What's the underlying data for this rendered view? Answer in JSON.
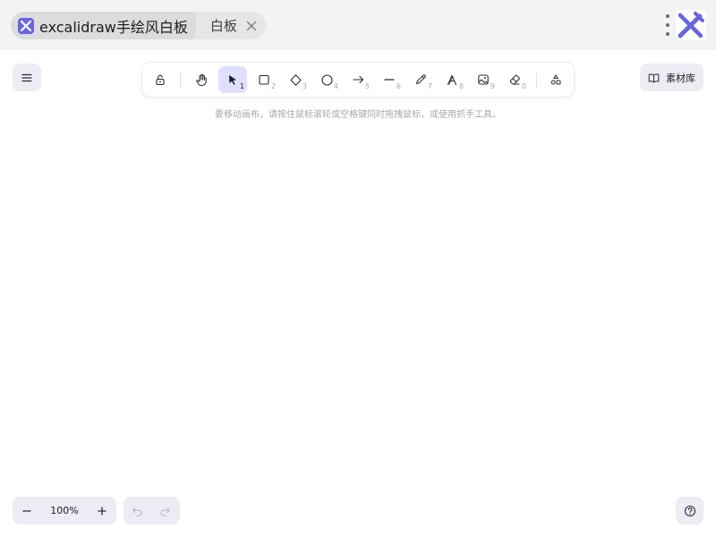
{
  "tabs": {
    "active_title": "excalidraw手绘风白板",
    "second_label": "白板"
  },
  "toolbar": {
    "tools": [
      {
        "name": "lock",
        "key": ""
      },
      {
        "name": "hand",
        "key": ""
      },
      {
        "name": "selection",
        "key": "1",
        "active": true
      },
      {
        "name": "rectangle",
        "key": "2"
      },
      {
        "name": "diamond",
        "key": "3"
      },
      {
        "name": "ellipse",
        "key": "4"
      },
      {
        "name": "arrow",
        "key": "5"
      },
      {
        "name": "line",
        "key": "6"
      },
      {
        "name": "pencil",
        "key": "7"
      },
      {
        "name": "text",
        "key": "8"
      },
      {
        "name": "image",
        "key": "9"
      },
      {
        "name": "eraser",
        "key": "0"
      },
      {
        "name": "more-shapes",
        "key": ""
      }
    ]
  },
  "library": {
    "label": "素材库"
  },
  "hint": "要移动画布，请按住鼠标滚轮或空格键同时拖拽鼠标，或使用抓手工具。",
  "zoom": {
    "value": "100%"
  },
  "colors": {
    "accent": "#6965db",
    "active_tool_bg": "#e0dfff",
    "island_bg": "#ececf4",
    "hint_text": "#a8a8ae"
  }
}
